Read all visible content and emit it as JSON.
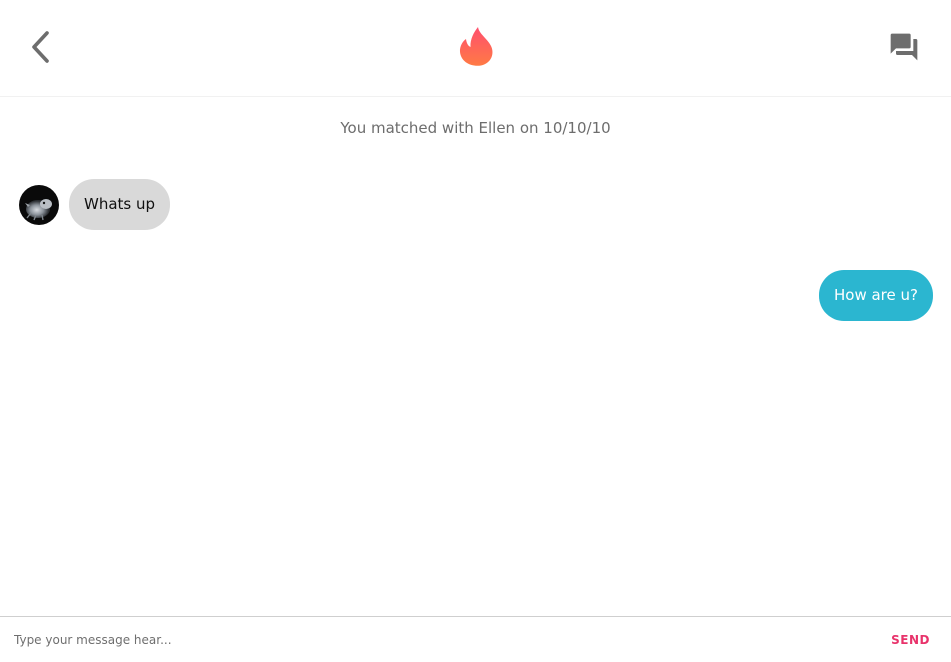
{
  "header": {
    "back_icon": "chevron-left-icon",
    "logo_icon": "flame-icon",
    "chat_icon": "forum-icon"
  },
  "colors": {
    "brand_gradient_top": "#ff4f6e",
    "brand_gradient_bottom": "#ff7a45",
    "outgoing_bubble": "#2bb6d0",
    "incoming_bubble": "#d9d9d9",
    "send_text": "#e8336b",
    "icon_gray": "#6d6d6d"
  },
  "conversation": {
    "match_notice": "You matched with Ellen on 10/10/10",
    "messages": [
      {
        "direction": "incoming",
        "text": "Whats up"
      },
      {
        "direction": "outgoing",
        "text": "How are u?"
      }
    ]
  },
  "composer": {
    "placeholder": "Type your message hear...",
    "value": "",
    "send_label": "SEND"
  }
}
